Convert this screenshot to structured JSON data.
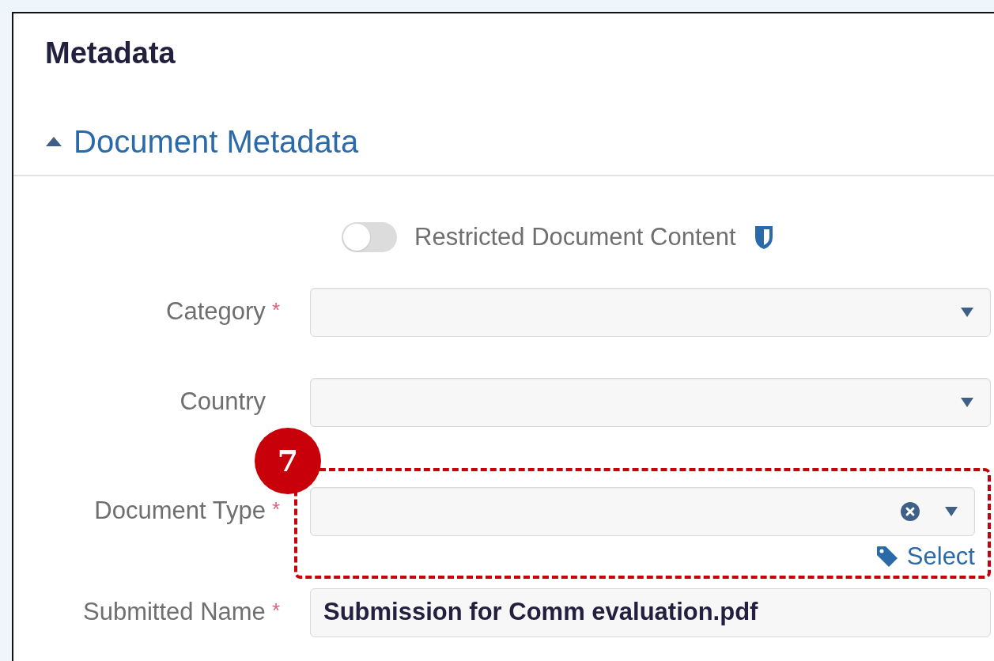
{
  "heading": "Metadata",
  "section": {
    "title": "Document Metadata",
    "expanded": true
  },
  "restricted_toggle": {
    "label": "Restricted Document Content",
    "on": false
  },
  "fields": [
    {
      "kind": "select",
      "label": "Category",
      "required_mark": "*",
      "clearable": false
    },
    {
      "kind": "select",
      "label": "Country",
      "clearable": false
    },
    {
      "kind": "select",
      "label": "Document Type",
      "required_mark": "*",
      "clearable": true,
      "link": "Select",
      "callout": "7"
    },
    {
      "kind": "text",
      "label": "Submitted Name",
      "required_mark": "*",
      "value": "Submission for Comm evaluation.pdf"
    }
  ]
}
